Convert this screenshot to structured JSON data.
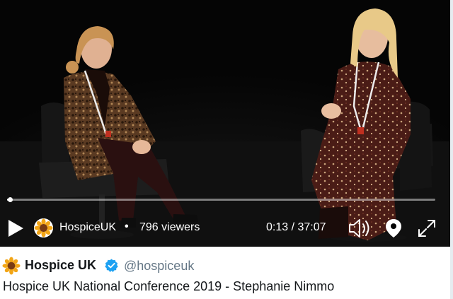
{
  "player": {
    "progress": 0.006,
    "controls": {
      "play_icon": "play-icon",
      "channel_name": "HospiceUK",
      "separator": "•",
      "viewers": "796 viewers",
      "time": "0:13 / 37:07",
      "volume_icon": "speaker-icon",
      "location_icon": "location-pin-icon",
      "fullscreen_icon": "expand-icon"
    }
  },
  "tweet": {
    "author_name": "Hospice UK",
    "verified_icon": "verified-badge-icon",
    "handle": "@hospiceuk",
    "title": "Hospice UK National Conference 2019 - Stephanie Nimmo"
  },
  "colors": {
    "accent": "#1da1f2",
    "sunflower_petal": "#f2a516",
    "sunflower_center": "#7a3b12",
    "video_background": "#050505"
  }
}
